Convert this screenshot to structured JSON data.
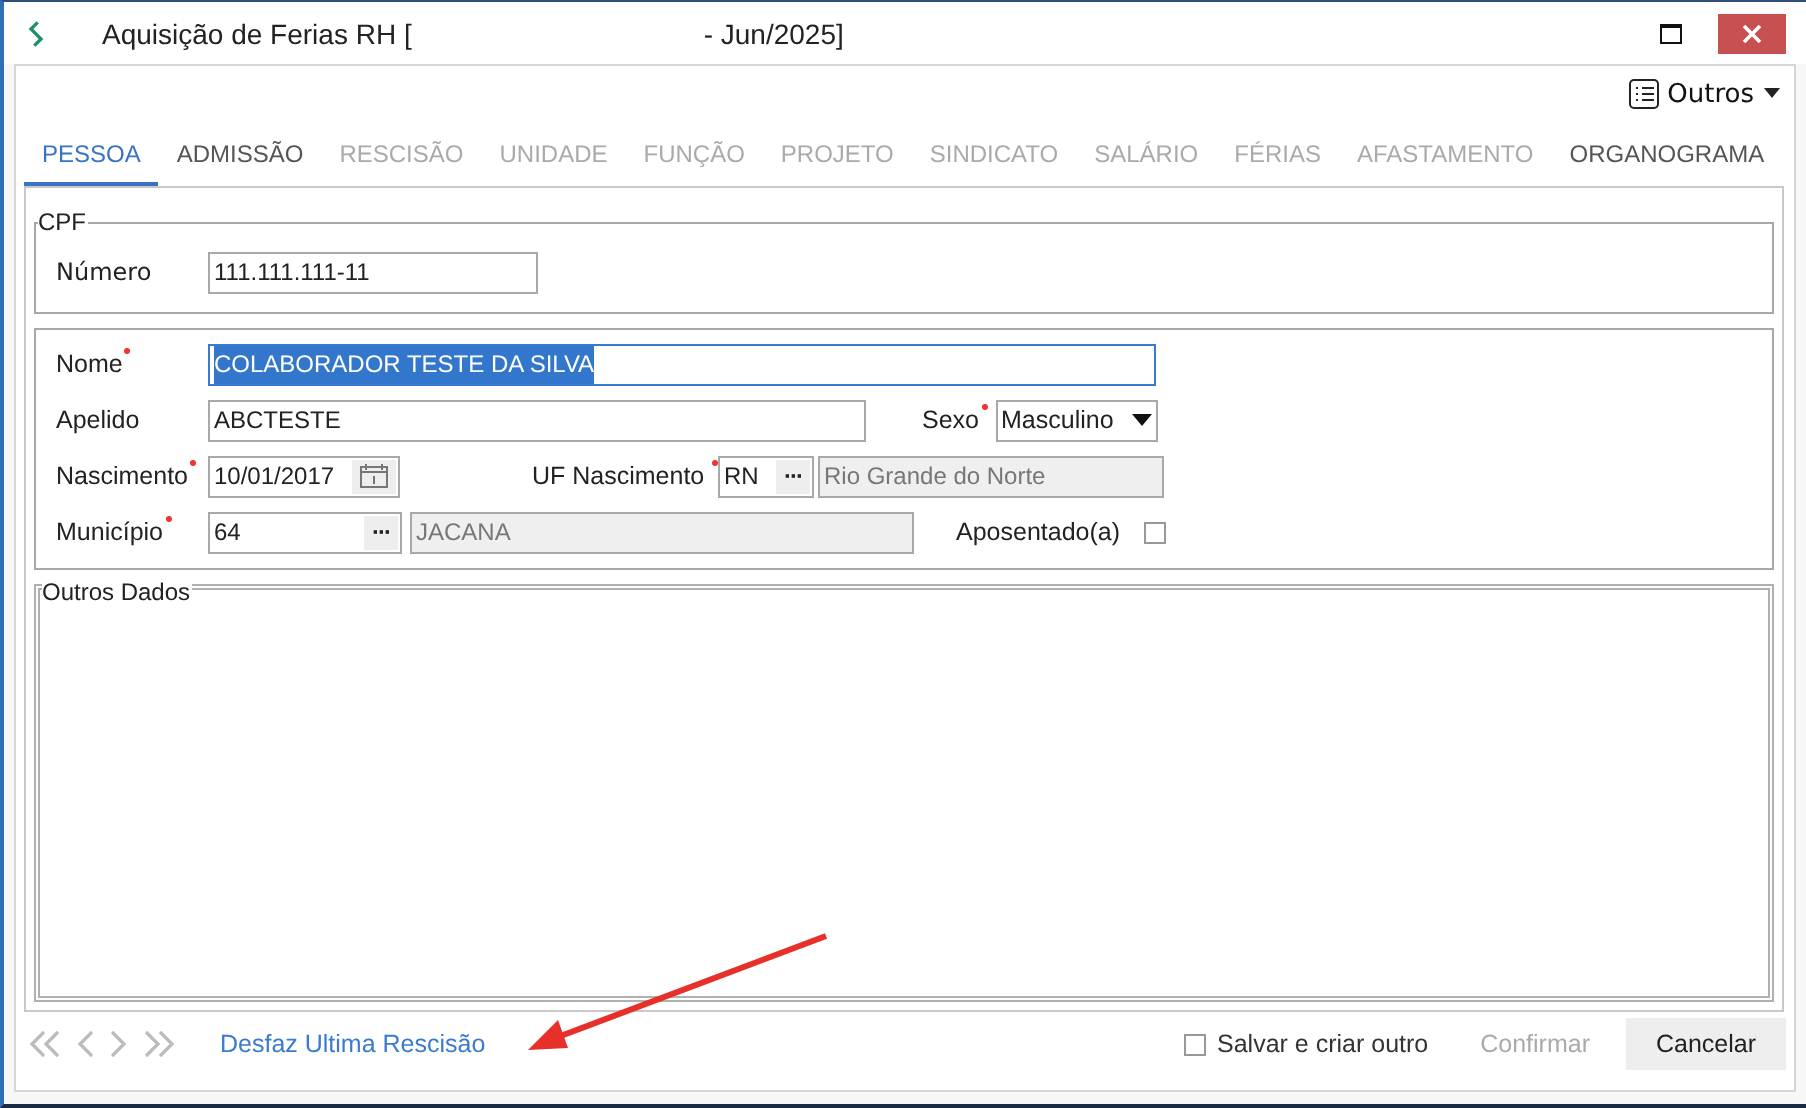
{
  "window": {
    "title_prefix": "Aquisição de Ferias RH [",
    "title_suffix": "- Jun/2025]"
  },
  "toolbar": {
    "menu_label": "Outros"
  },
  "tabs": [
    {
      "label": "PESSOA",
      "selected": true,
      "disabled": false
    },
    {
      "label": "ADMISSÃO",
      "selected": false,
      "disabled": false
    },
    {
      "label": "RESCISÃO",
      "selected": false,
      "disabled": true
    },
    {
      "label": "UNIDADE",
      "selected": false,
      "disabled": true
    },
    {
      "label": "FUNÇÃO",
      "selected": false,
      "disabled": true
    },
    {
      "label": "PROJETO",
      "selected": false,
      "disabled": true
    },
    {
      "label": "SINDICATO",
      "selected": false,
      "disabled": true
    },
    {
      "label": "SALÁRIO",
      "selected": false,
      "disabled": true
    },
    {
      "label": "FÉRIAS",
      "selected": false,
      "disabled": true
    },
    {
      "label": "AFASTAMENTO",
      "selected": false,
      "disabled": true
    },
    {
      "label": "ORGANOGRAMA",
      "selected": false,
      "disabled": false
    }
  ],
  "cpf_group": {
    "title": "CPF",
    "numero": {
      "label": "Número",
      "value": "111.111.111-11"
    }
  },
  "person_group": {
    "nome": {
      "label": "Nome",
      "required": true,
      "value": "COLABORADOR TESTE DA SILVA",
      "highlighted": true
    },
    "apelido": {
      "label": "Apelido",
      "value": "ABCTESTE"
    },
    "sexo": {
      "label": "Sexo",
      "required": true,
      "value": "Masculino"
    },
    "nascimento": {
      "label": "Nascimento",
      "required": true,
      "value": "10/01/2017"
    },
    "uf_nascimento": {
      "label": "UF Nascimento",
      "required": true,
      "code": "RN",
      "lookup_button": "···",
      "name": "Rio Grande do Norte"
    },
    "municipio": {
      "label": "Município",
      "required": true,
      "code": "64",
      "lookup_button": "···",
      "name": "JACANA"
    },
    "aposentado": {
      "label": "Aposentado(a)",
      "checked": false
    }
  },
  "outros_dados": {
    "title": "Outros Dados"
  },
  "footer": {
    "link": "Desfaz Ultima Rescisão",
    "save_another": {
      "label": "Salvar e criar outro",
      "checked": false
    },
    "confirm": {
      "label": "Confirmar",
      "disabled": true
    },
    "cancel": {
      "label": "Cancelar",
      "disabled": false
    }
  }
}
